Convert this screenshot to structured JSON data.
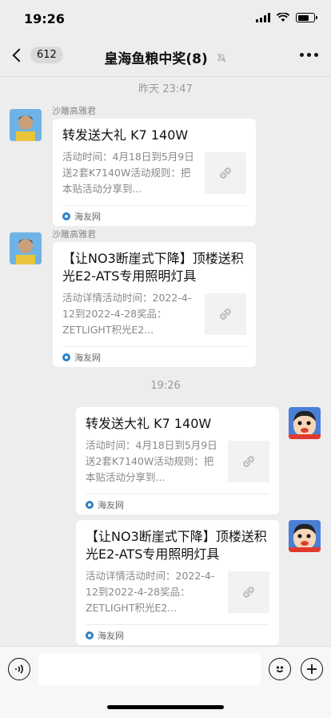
{
  "status": {
    "time": "19:26"
  },
  "nav": {
    "back_count": "612",
    "title": "皇海鱼粮中奖(8)"
  },
  "chat": {
    "time_labels": [
      "昨天 23:47",
      "19:26"
    ],
    "messages": [
      {
        "sender": "沙雕高雅君",
        "title": "转发送大礼 K7 140W",
        "desc": "活动时间：4月18日到5月9日送2套K7140W活动规则：把本贴活动分享到...",
        "source": "海友网"
      },
      {
        "sender": "沙雕高雅君",
        "title": "【让NO3断崖式下降】顶楼送积光E2-ATS专用照明灯具",
        "desc": "活动详情活动时间：2022-4-12到2022-4-28奖品：ZETLIGHT积光E2...",
        "source": "海友网"
      },
      {
        "title": "转发送大礼 K7 140W",
        "desc": "活动时间：4月18日到5月9日送2套K7140W活动规则：把本贴活动分享到...",
        "source": "海友网"
      },
      {
        "title": "【让NO3断崖式下降】顶楼送积光E2-ATS专用照明灯具",
        "desc": "活动详情活动时间：2022-4-12到2022-4-28奖品：ZETLIGHT积光E2...",
        "source": "海友网"
      }
    ]
  },
  "colors": {
    "background": "#ededed",
    "card": "#ffffff",
    "secondary_text": "#888888"
  }
}
